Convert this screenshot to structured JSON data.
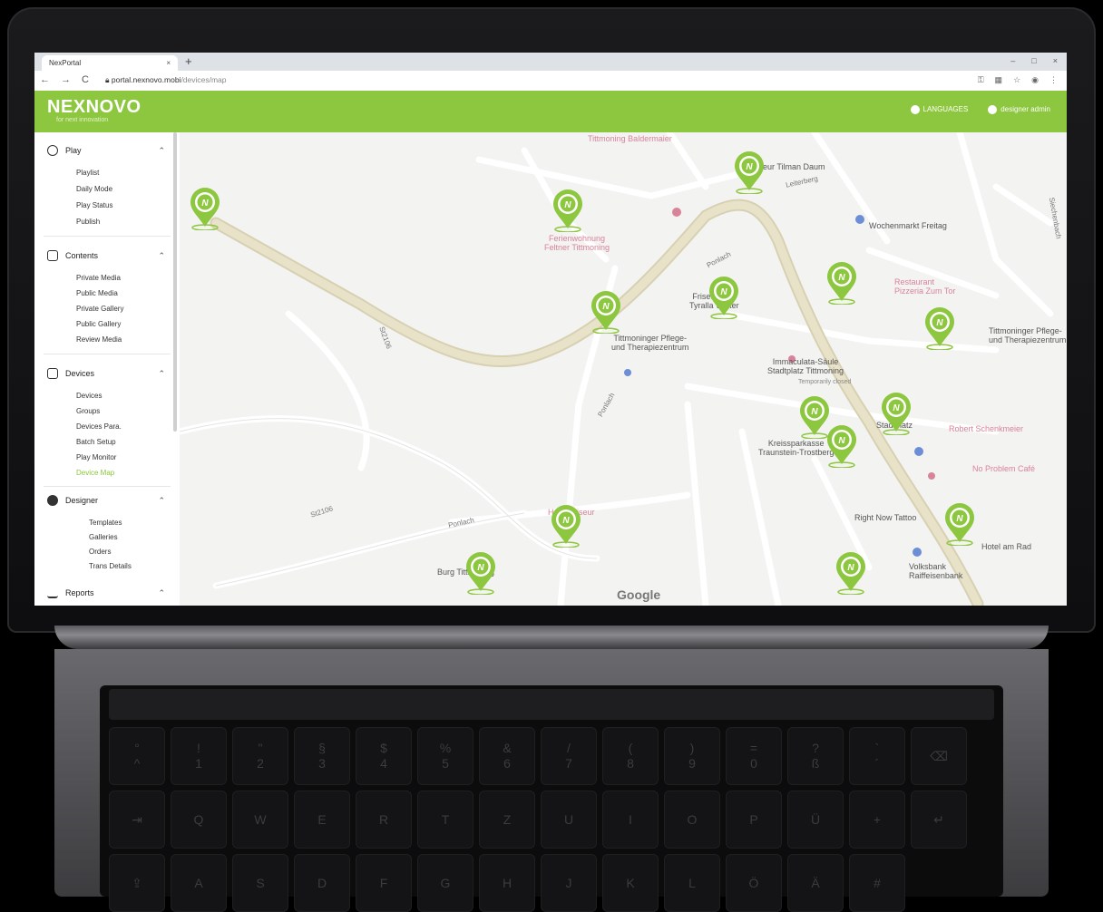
{
  "browser": {
    "tab_title": "NexPortal",
    "tab_close": "×",
    "new_tab": "+",
    "url_host": "portal.nexnovo.mobi",
    "url_path": "/devices/map",
    "nav_back": "←",
    "nav_forward": "→",
    "nav_reload": "C",
    "window_controls": [
      "–",
      "□",
      "×"
    ]
  },
  "header": {
    "logo": "NEXNOVO",
    "tagline": "for next innovation",
    "languages_label": "LANGUAGES",
    "user_label": "designer admin",
    "color": "#8dc63f"
  },
  "sidebar": {
    "sections": [
      {
        "label": "Play",
        "icon": "play-circle-icon",
        "items": [
          "Playlist",
          "Daily Mode",
          "Play Status",
          "Publish"
        ]
      },
      {
        "label": "Contents",
        "icon": "image-icon",
        "items": [
          "Private Media",
          "Public Media",
          "Private Gallery",
          "Public Gallery",
          "Review Media"
        ]
      },
      {
        "label": "Devices",
        "icon": "monitor-icon",
        "items": [
          "Devices",
          "Groups",
          "Devices Para.",
          "Batch Setup",
          "Play Monitor",
          "Device Map"
        ]
      },
      {
        "label": "Designer",
        "icon": "palette-icon",
        "items": [
          "Templates",
          "Galleries",
          "Orders",
          "Trans Details"
        ]
      },
      {
        "label": "Reports",
        "icon": "bar-chart-icon",
        "items": []
      }
    ],
    "active_item": "Device Map"
  },
  "map": {
    "labels": {
      "tittmoning_baldermaier": "Tittmoning Baldermaier",
      "friseur_tilman": "Friseur Tilman Daum",
      "leiterberg": "Leiterberg",
      "wochenmarkt": "Wochenmarkt Freitag",
      "ferienwohnung": "Ferienwohnung\nFeltner Tittmoning",
      "restaurant": "Restaurant\nPizzeria Zum Tor",
      "friseurteam": "Friseurteam\nTyralla Walter",
      "pflege_1": "Tittmoninger Pflege-\nund Therapiezentrum",
      "pflege_2": "Tittmoninger Pflege-\nund Therapiezentrum",
      "immaculata": "Immaculata-Säule\nStadtplatz Tittmoning",
      "temporarily_closed": "Temporarily closed",
      "stadtplatz": "Stadtplatz",
      "robert": "Robert Schenkmeier",
      "kreissparkasse": "Kreissparkasse\nTraunstein-Trostberg",
      "no_problem": "No Problem Café",
      "right_now": "Right Now Tattoo",
      "hotel": "Hotel am Rad",
      "volksbank": "Volksbank\nRaiffeisenbank",
      "burg": "Burg Tittmoning",
      "hans": "Hans Friseur",
      "ponlach_1": "Ponlach",
      "ponlach_2": "Ponlach",
      "ponlach_3": "Ponlach",
      "st2106_1": "St2106",
      "st2106_2": "St2106",
      "siechenbach": "Siechenbach",
      "google": "Google"
    },
    "pin_color": "#8dc63f"
  },
  "keyboard": {
    "row1": [
      [
        "°",
        "^"
      ],
      [
        "!",
        "1"
      ],
      [
        "\"",
        "2"
      ],
      [
        "§",
        "3"
      ],
      [
        "$",
        "4"
      ],
      [
        "%",
        "5"
      ],
      [
        "&",
        "6"
      ],
      [
        "/",
        "7"
      ],
      [
        "(",
        "8"
      ],
      [
        ")",
        "9"
      ],
      [
        "=",
        "0"
      ],
      [
        "?",
        "ß"
      ],
      [
        "`",
        "´"
      ],
      [
        "",
        "⌫"
      ]
    ],
    "row2": [
      "⇥",
      "Q",
      "W",
      "E",
      "R",
      "T",
      "Z",
      "U",
      "I",
      "O",
      "P",
      "Ü",
      "+",
      "↵"
    ],
    "row3": [
      "⇪",
      "A",
      "S",
      "D",
      "F",
      "G",
      "H",
      "J",
      "K",
      "L",
      "Ö",
      "Ä",
      "#"
    ]
  }
}
